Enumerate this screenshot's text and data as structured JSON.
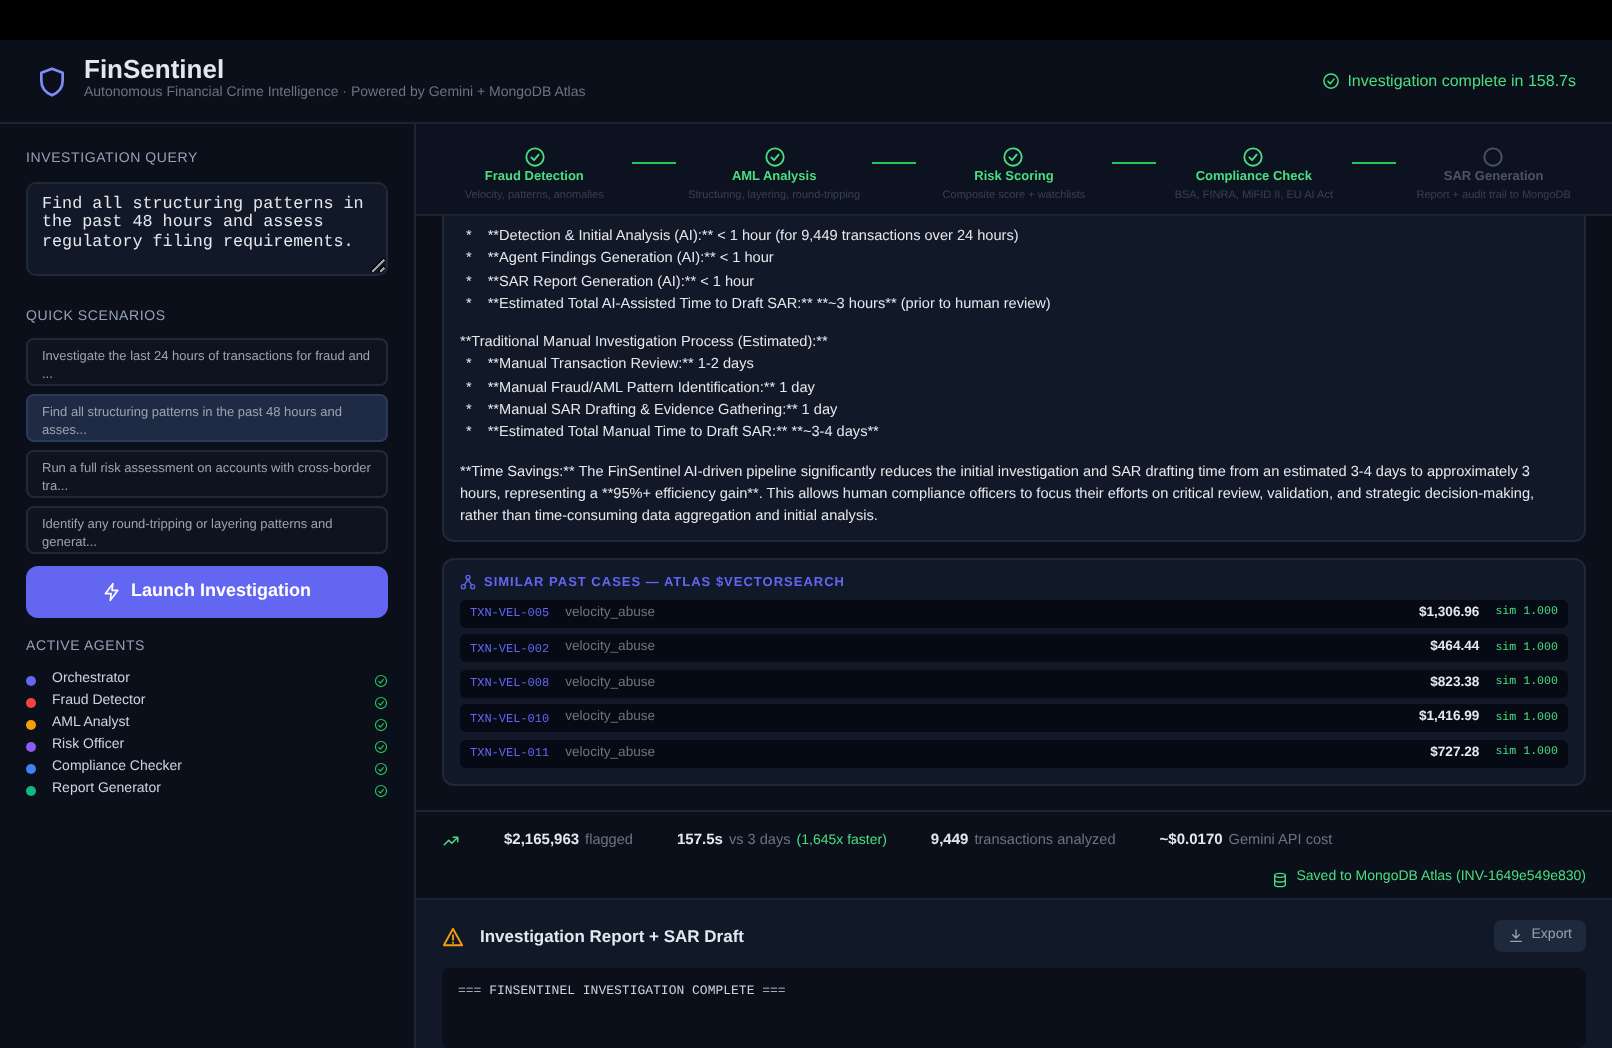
{
  "header": {
    "title": "FinSentinel",
    "subtitle": "Autonomous Financial Crime Intelligence · Powered by Gemini + MongoDB Atlas",
    "status": "Investigation complete in 158.7s"
  },
  "sidebar": {
    "query_label": "INVESTIGATION QUERY",
    "query": "Find all structuring patterns in the past 48 hours and assess regulatory filing requirements.",
    "scenarios_label": "QUICK SCENARIOS",
    "scenarios": [
      {
        "text": "Investigate the last 24 hours of transactions for fraud and ...",
        "selected": false
      },
      {
        "text": "Find all structuring patterns in the past 48 hours and asses...",
        "selected": true
      },
      {
        "text": "Run a full risk assessment on accounts with cross-border tra...",
        "selected": false
      },
      {
        "text": "Identify any round-tripping or layering patterns and generat...",
        "selected": false
      }
    ],
    "launch_button": "Launch Investigation",
    "agents_label": "ACTIVE AGENTS",
    "agents": [
      {
        "name": "Orchestrator",
        "color": "#6366f1",
        "done": true
      },
      {
        "name": "Fraud Detector",
        "color": "#ef4444",
        "done": true
      },
      {
        "name": "AML Analyst",
        "color": "#f59e0b",
        "done": true
      },
      {
        "name": "Risk Officer",
        "color": "#8b5cf6",
        "done": true
      },
      {
        "name": "Compliance Checker",
        "color": "#3b82f6",
        "done": true
      },
      {
        "name": "Report Generator",
        "color": "#10b981",
        "done": true
      }
    ]
  },
  "steps": [
    {
      "title": "Fraud Detection",
      "subtitle": "Velocity, patterns, anomalies",
      "done": true
    },
    {
      "title": "AML Analysis",
      "subtitle": "Structuring, layering, round-tripping",
      "done": true
    },
    {
      "title": "Risk Scoring",
      "subtitle": "Composite score + watchlists",
      "done": true
    },
    {
      "title": "Compliance Check",
      "subtitle": "BSA, FINRA, MiFID II, EU AI Act",
      "done": true
    },
    {
      "title": "SAR Generation",
      "subtitle": "Report + audit trail to MongoDB",
      "done": false
    }
  ],
  "summary_lines": [
    {
      "kind": "bullet",
      "marker": "*",
      "text": "**Detection & Initial Analysis (AI):** < 1 hour (for 9,449 transactions over 24 hours)"
    },
    {
      "kind": "bullet",
      "marker": "*",
      "text": "**Agent Findings Generation (AI):** < 1 hour"
    },
    {
      "kind": "bullet",
      "marker": "*",
      "text": "**SAR Report Generation (AI):** < 1 hour"
    },
    {
      "kind": "bullet",
      "marker": "*",
      "text": "**Estimated Total AI-Assisted Time to Draft SAR:** **~3 hours** (prior to human review)"
    },
    {
      "kind": "para",
      "text": "**Traditional Manual Investigation Process (Estimated):**"
    },
    {
      "kind": "bullet",
      "marker": "*",
      "text": "**Manual Transaction Review:** 1-2 days"
    },
    {
      "kind": "bullet",
      "marker": "*",
      "text": "**Manual Fraud/AML Pattern Identification:** 1 day"
    },
    {
      "kind": "bullet",
      "marker": "*",
      "text": "**Manual SAR Drafting & Evidence Gathering:** 1 day"
    },
    {
      "kind": "bullet",
      "marker": "*",
      "text": "**Estimated Total Manual Time to Draft SAR:** **~3-4 days**"
    },
    {
      "kind": "para",
      "text": "**Time Savings:** The FinSentinel AI-driven pipeline significantly reduces the initial investigation and SAR drafting time from an estimated 3-4 days to approximately 3 hours, representing a **95%+ efficiency gain**. This allows human compliance officers to focus their efforts on critical review, validation, and strategic decision-making, rather than time-consuming data aggregation and initial analysis."
    }
  ],
  "similar_cases": {
    "title": "SIMILAR PAST CASES — ATLAS $VECTORSEARCH",
    "rows": [
      {
        "id": "TXN-VEL-005",
        "type": "velocity_abuse",
        "amount": "$1,306.96",
        "sim": "sim 1.000"
      },
      {
        "id": "TXN-VEL-002",
        "type": "velocity_abuse",
        "amount": "$464.44",
        "sim": "sim 1.000"
      },
      {
        "id": "TXN-VEL-008",
        "type": "velocity_abuse",
        "amount": "$823.38",
        "sim": "sim 1.000"
      },
      {
        "id": "TXN-VEL-010",
        "type": "velocity_abuse",
        "amount": "$1,416.99",
        "sim": "sim 1.000"
      },
      {
        "id": "TXN-VEL-011",
        "type": "velocity_abuse",
        "amount": "$727.28",
        "sim": "sim 1.000"
      }
    ]
  },
  "stats": [
    {
      "value": "$2,165,963",
      "label": "flagged"
    },
    {
      "value": "157.5s",
      "label": "vs 3 days",
      "note": "(1,645x faster)"
    },
    {
      "value": "9,449",
      "label": "transactions analyzed"
    },
    {
      "value": "~$0.0170",
      "label": "Gemini API cost"
    }
  ],
  "saved": "Saved to MongoDB Atlas (INV-1649e549e830)",
  "report": {
    "title": "Investigation Report + SAR Draft",
    "export": "Export",
    "first_line": "=== FINSENTINEL INVESTIGATION COMPLETE ==="
  }
}
